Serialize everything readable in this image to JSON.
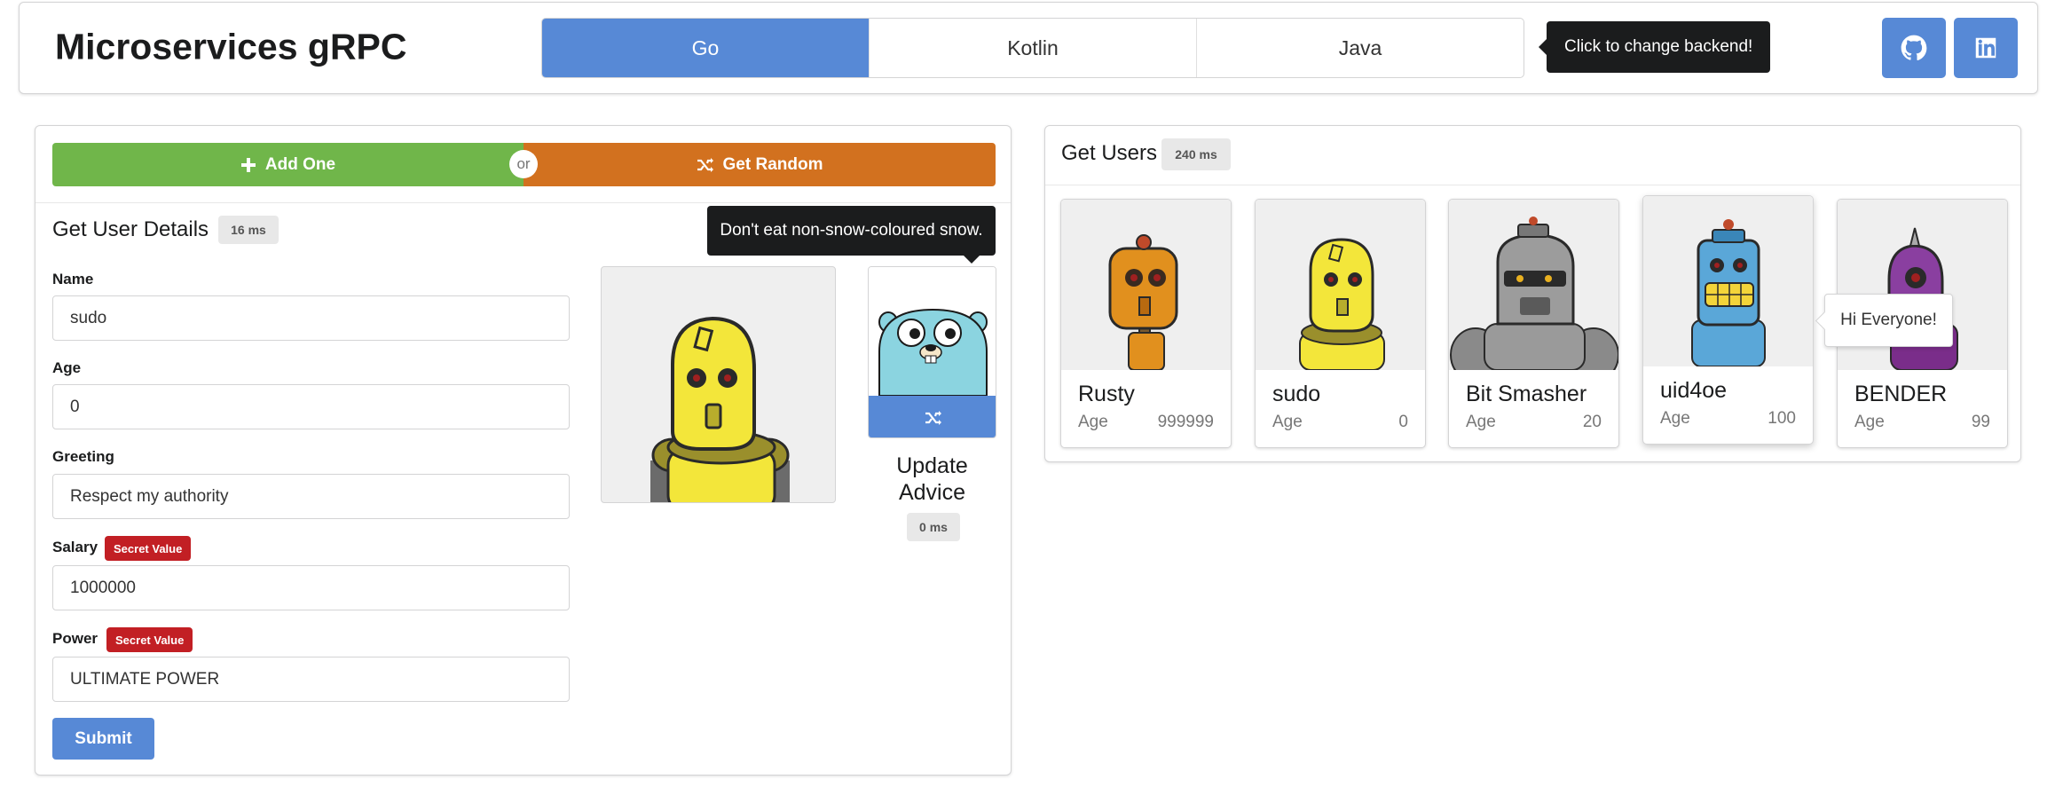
{
  "header": {
    "title": "Microservices gRPC",
    "backends": [
      "Go",
      "Kotlin",
      "Java"
    ],
    "active_backend": "Go",
    "tooltip": "Click to change backend!",
    "social": [
      "github-icon",
      "linkedin-icon"
    ]
  },
  "actions": {
    "add_label": "Add One",
    "or_label": "or",
    "random_label": "Get Random"
  },
  "user_details": {
    "title": "Get User Details",
    "timing": "16 ms",
    "fields": {
      "name": {
        "label": "Name",
        "value": "sudo"
      },
      "age": {
        "label": "Age",
        "value": "0"
      },
      "greeting": {
        "label": "Greeting",
        "value": "Respect my authority"
      },
      "salary": {
        "label": "Salary",
        "value": "1000000",
        "badge": "Secret Value"
      },
      "power": {
        "label": "Power",
        "value": "ULTIMATE POWER",
        "badge": "Secret Value"
      }
    },
    "submit_label": "Submit"
  },
  "advice": {
    "tooltip": "Don't eat non-snow-coloured snow.",
    "title": "Update Advice",
    "timing": "0 ms"
  },
  "users": {
    "title": "Get Users",
    "timing": "240 ms",
    "age_label": "Age",
    "hover_tooltip": "Hi Everyone!",
    "list": [
      {
        "name": "Rusty",
        "age": "999999"
      },
      {
        "name": "sudo",
        "age": "0"
      },
      {
        "name": "Bit Smasher",
        "age": "20"
      },
      {
        "name": "uid4oe",
        "age": "100"
      },
      {
        "name": "BENDER",
        "age": "99"
      }
    ]
  },
  "colors": {
    "primary": "#5789d6",
    "green": "#70b64a",
    "orange": "#d2711f",
    "secret": "#c21f24",
    "dark": "#1b1c1d"
  }
}
